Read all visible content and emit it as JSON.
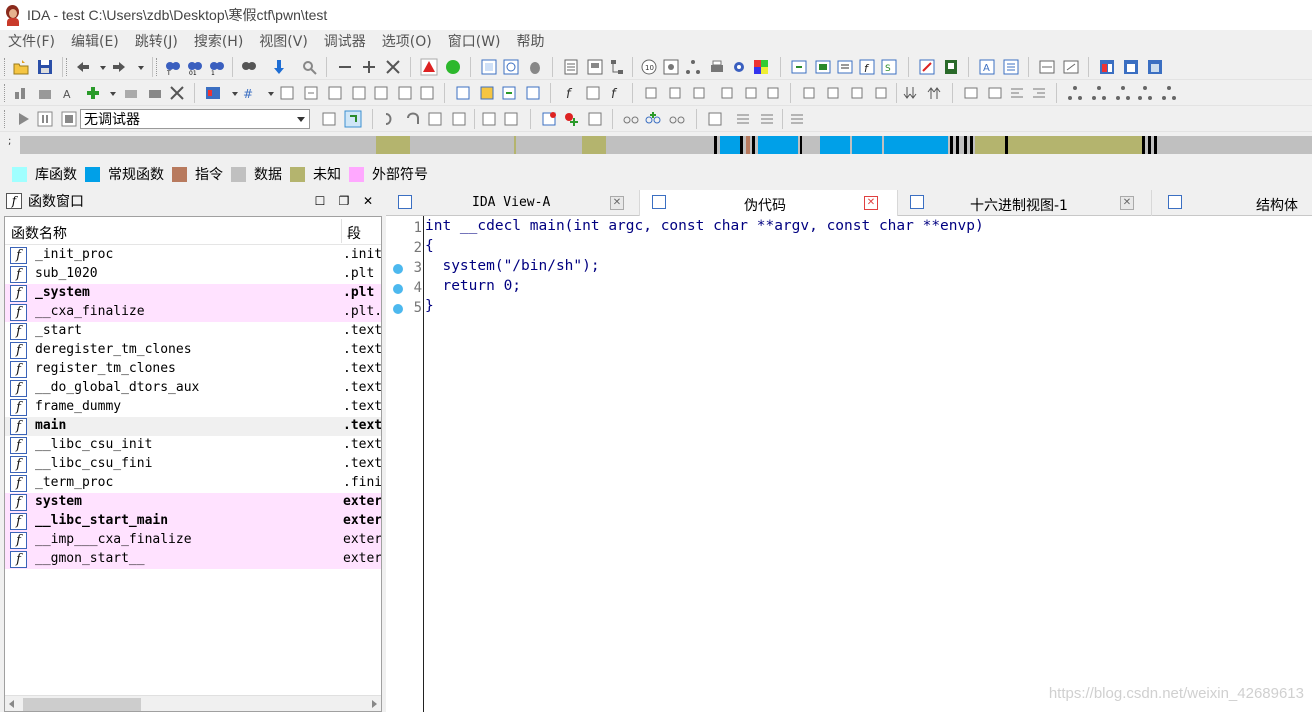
{
  "window": {
    "title": "IDA - test C:\\Users\\zdb\\Desktop\\寒假ctf\\pwn\\test"
  },
  "menu": {
    "items": [
      "文件(F)",
      "编辑(E)",
      "跳转(J)",
      "搜索(H)",
      "视图(V)",
      "调试器",
      "选项(O)",
      "窗口(W)",
      "帮助"
    ]
  },
  "debugger": {
    "selected": "无调试器"
  },
  "legend": [
    {
      "label": "库函数",
      "color": "#a0ffff"
    },
    {
      "label": "常规函数",
      "color": "#00a0e8"
    },
    {
      "label": "指令",
      "color": "#b87a5e"
    },
    {
      "label": "数据",
      "color": "#c0c0c0"
    },
    {
      "label": "未知",
      "color": "#b4b46e"
    },
    {
      "label": "外部符号",
      "color": "#ffa8ff"
    }
  ],
  "navbar": {
    "arrow": ";",
    "colors": {
      "data": "#c0c0c0",
      "unknown": "#b4b46e",
      "regular": "#00a0e8",
      "instruction": "#b87a5e",
      "black": "#000000"
    }
  },
  "functions_window": {
    "title": "函数窗口",
    "col_name": "函数名称",
    "col_segment": "段",
    "icon_glyph": "f",
    "rows": [
      {
        "name": "_init_proc",
        "segment": ".init",
        "style": "normal"
      },
      {
        "name": "sub_1020",
        "segment": ".plt",
        "style": "normal"
      },
      {
        "name": "_system",
        "segment": ".plt",
        "style": "pink-bold"
      },
      {
        "name": "__cxa_finalize",
        "segment": ".plt.",
        "style": "pink"
      },
      {
        "name": "_start",
        "segment": ".text",
        "style": "normal"
      },
      {
        "name": "deregister_tm_clones",
        "segment": ".text",
        "style": "normal"
      },
      {
        "name": "register_tm_clones",
        "segment": ".text",
        "style": "normal"
      },
      {
        "name": "__do_global_dtors_aux",
        "segment": ".text",
        "style": "normal"
      },
      {
        "name": "frame_dummy",
        "segment": ".text",
        "style": "normal"
      },
      {
        "name": "main",
        "segment": ".text",
        "style": "selected-bold"
      },
      {
        "name": "__libc_csu_init",
        "segment": ".text",
        "style": "normal"
      },
      {
        "name": "__libc_csu_fini",
        "segment": ".text",
        "style": "normal"
      },
      {
        "name": "_term_proc",
        "segment": ".fini",
        "style": "normal"
      },
      {
        "name": "system",
        "segment": "exter",
        "style": "pink-bold"
      },
      {
        "name": "__libc_start_main",
        "segment": "exter",
        "style": "pink-bold"
      },
      {
        "name": "__imp___cxa_finalize",
        "segment": "exter",
        "style": "pink"
      },
      {
        "name": "__gmon_start__",
        "segment": "exter",
        "style": "pink"
      }
    ]
  },
  "tabs": [
    {
      "label": "IDA View-A",
      "icon": "ida-view-icon",
      "active": false
    },
    {
      "label": "伪代码",
      "icon": "pseudocode-icon",
      "active": true
    },
    {
      "label": "十六进制视图-1",
      "icon": "hex-view-icon",
      "active": false
    },
    {
      "label": "结构体",
      "icon": "structures-icon",
      "active": false
    }
  ],
  "code": {
    "lines": [
      {
        "num": "1",
        "dot": false,
        "text": "int __cdecl main(int argc, const char **argv, const char **envp)"
      },
      {
        "num": "2",
        "dot": false,
        "text": "{"
      },
      {
        "num": "3",
        "dot": true,
        "text": "  system(\"/bin/sh\");"
      },
      {
        "num": "4",
        "dot": true,
        "text": "  return 0;"
      },
      {
        "num": "5",
        "dot": true,
        "text": "}"
      }
    ]
  },
  "watermark": "https://blog.csdn.net/weixin_42689613"
}
